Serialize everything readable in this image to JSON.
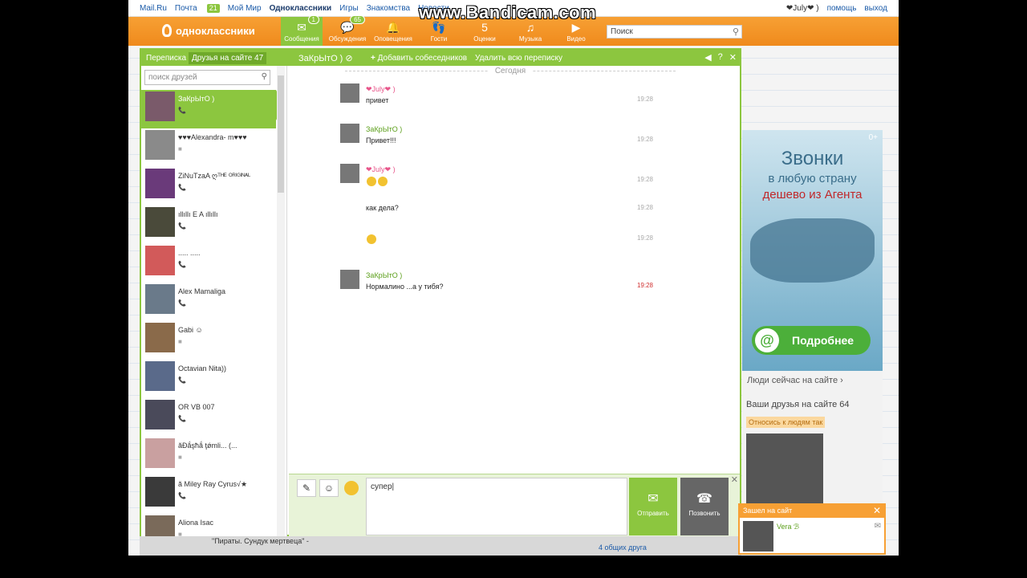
{
  "watermark": "www.Bandicam.com",
  "topbar": {
    "links": [
      {
        "label": "Mail.Ru"
      },
      {
        "label": "Почта",
        "badge": "21"
      },
      {
        "label": "Мой Мир"
      },
      {
        "label": "Одноклассники",
        "bold": true
      },
      {
        "label": "Игры"
      },
      {
        "label": "Знакомства"
      },
      {
        "label": "Новости"
      }
    ],
    "user": "❤July❤ )",
    "help": "помощь",
    "exit": "выход"
  },
  "nav": {
    "logo": "одноклассники",
    "items": [
      {
        "label": "Сообщения",
        "icon": "✉",
        "count": "1",
        "active": true
      },
      {
        "label": "Обсуждения",
        "icon": "💬",
        "count": "65"
      },
      {
        "label": "Оповещения",
        "icon": "🔔"
      },
      {
        "label": "Гости",
        "icon": "👣"
      },
      {
        "label": "Оценки",
        "icon": "5"
      },
      {
        "label": "Музыка",
        "icon": "♫"
      },
      {
        "label": "Видео",
        "icon": "▶"
      }
    ],
    "search_placeholder": "Поиск"
  },
  "messenger": {
    "tab_conversations": "Переписка",
    "tab_online": "Друзья на сайте 47",
    "chat_name": "ЗаКрЫтО )",
    "add_label": "Добавить собеседников",
    "delete_label": "Удалить всю переписку",
    "friend_search_placeholder": "поиск друзей",
    "friends": [
      {
        "name": "ЗаКрЫтО )",
        "status": "📞",
        "selected": true
      },
      {
        "name": "♥♥♥Alexandra- m♥♥♥",
        "status": "■"
      },
      {
        "name": "ZiNuTzaA ღᵀᴴᴱ ᴼᴿᴵᴳᴵᴺᴬᴸ",
        "status": "📞"
      },
      {
        "name": "ıllıllı E A ıllıllı",
        "status": "📞"
      },
      {
        "name": "..... .....",
        "status": "📞"
      },
      {
        "name": "Alex Mamaliga",
        "status": "📞"
      },
      {
        "name": "Gabi ☺",
        "status": "■"
      },
      {
        "name": "Octavian Nita))",
        "status": "📞"
      },
      {
        "name": "OR VB 007",
        "status": "📞"
      },
      {
        "name": "ăĐắşħắ ţǿmli... (...",
        "status": "■"
      },
      {
        "name": "ă Miley Ray Cyrus√★",
        "status": "📞"
      },
      {
        "name": "Aliona Isac",
        "status": "■"
      }
    ],
    "today_label": "Сегодня",
    "messages": [
      {
        "author": "❤July❤ )",
        "color": "pink",
        "text": "привет",
        "time": "19:28"
      },
      {
        "author": "ЗаКрЫтО )",
        "color": "green",
        "text": "Привет!!!",
        "time": "19:28"
      },
      {
        "author": "❤July❤ )",
        "color": "pink",
        "text": "",
        "time": "19:28",
        "smileys": 2
      },
      {
        "author": "",
        "color": "pink",
        "text": "как дела?",
        "time": "19:28"
      },
      {
        "author": "",
        "color": "pink",
        "text": "",
        "time": "19:28",
        "smileys": 1
      },
      {
        "author": "ЗаКрЫтО )",
        "color": "green",
        "text": "Нормалино ...а у тибя?",
        "time": "19:28"
      }
    ],
    "input_text": "супер",
    "send_label": "Отправить",
    "call_label": "Позвонить"
  },
  "ad": {
    "line1": "Звонки",
    "line2": "в любую страну",
    "line3": "дешево из Агента",
    "button": "Подробнее",
    "plus": "0+"
  },
  "rightcol": {
    "people_now": "Люди сейчас на сайте ›",
    "friends_online": "Ваши друзья на сайте 64",
    "relate": "Относись к людям так"
  },
  "popup": {
    "title": "Зашел на сайт",
    "name": "Vera ℬ"
  },
  "bottom": {
    "game": "\"Пираты. Сундук мертвеца\" -",
    "common": "4 общих друга"
  }
}
